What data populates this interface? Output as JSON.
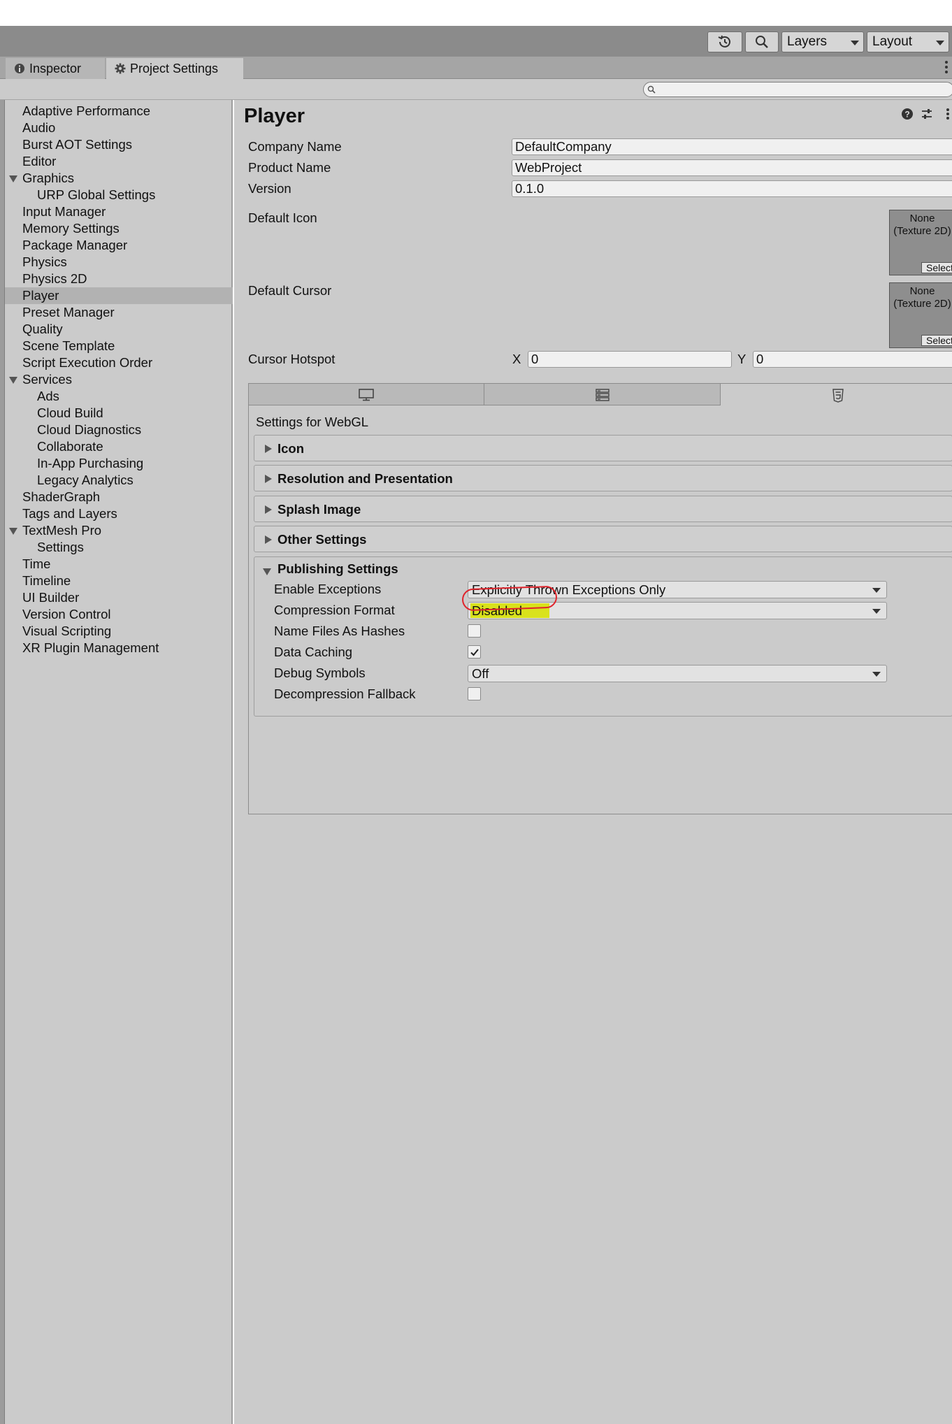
{
  "toolbar": {
    "history_icon": "history-icon",
    "search_icon": "search-icon",
    "layers_label": "Layers",
    "layout_label": "Layout"
  },
  "tabs": [
    {
      "label": "Inspector",
      "icon": "info-icon",
      "active": false
    },
    {
      "label": "Project Settings",
      "icon": "gear-icon",
      "active": true
    }
  ],
  "search": {
    "placeholder": ""
  },
  "sidebar": {
    "items": [
      {
        "label": "Adaptive Performance"
      },
      {
        "label": "Audio"
      },
      {
        "label": "Burst AOT Settings"
      },
      {
        "label": "Editor"
      },
      {
        "label": "Graphics",
        "expanded": true
      },
      {
        "label": "URP Global Settings"
      },
      {
        "label": "Input Manager"
      },
      {
        "label": "Memory Settings"
      },
      {
        "label": "Package Manager"
      },
      {
        "label": "Physics"
      },
      {
        "label": "Physics 2D"
      },
      {
        "label": "Player",
        "selected": true
      },
      {
        "label": "Preset Manager"
      },
      {
        "label": "Quality"
      },
      {
        "label": "Scene Template"
      },
      {
        "label": "Script Execution Order"
      },
      {
        "label": "Services",
        "expanded": true
      },
      {
        "label": "Ads"
      },
      {
        "label": "Cloud Build"
      },
      {
        "label": "Cloud Diagnostics"
      },
      {
        "label": "Collaborate"
      },
      {
        "label": "In-App Purchasing"
      },
      {
        "label": "Legacy Analytics"
      },
      {
        "label": "ShaderGraph"
      },
      {
        "label": "Tags and Layers"
      },
      {
        "label": "TextMesh Pro",
        "expanded": true
      },
      {
        "label": "Settings"
      },
      {
        "label": "Time"
      },
      {
        "label": "Timeline"
      },
      {
        "label": "UI Builder"
      },
      {
        "label": "Version Control"
      },
      {
        "label": "Visual Scripting"
      },
      {
        "label": "XR Plugin Management"
      }
    ]
  },
  "player": {
    "title": "Player",
    "company_name_label": "Company Name",
    "company_name_value": "DefaultCompany",
    "product_name_label": "Product Name",
    "product_name_value": "WebProject",
    "version_label": "Version",
    "version_value": "0.1.0",
    "default_icon_label": "Default Icon",
    "default_cursor_label": "Default Cursor",
    "texture_none": "None",
    "texture_type": "(Texture 2D)",
    "select_label": "Select",
    "cursor_hotspot_label": "Cursor Hotspot",
    "hotspot_x_label": "X",
    "hotspot_x_value": "0",
    "hotspot_y_label": "Y",
    "hotspot_y_value": "0"
  },
  "platform": {
    "tabs": [
      "desktop-icon",
      "server-icon",
      "html5-icon"
    ],
    "settings_for": "Settings for WebGL",
    "sections": [
      {
        "label": "Icon",
        "expanded": false
      },
      {
        "label": "Resolution and Presentation",
        "expanded": false
      },
      {
        "label": "Splash Image",
        "expanded": false
      },
      {
        "label": "Other Settings",
        "expanded": false
      },
      {
        "label": "Publishing Settings",
        "expanded": true
      }
    ]
  },
  "publishing": {
    "enable_exceptions_label": "Enable Exceptions",
    "enable_exceptions_value": "Explicitly Thrown Exceptions Only",
    "compression_format_label": "Compression Format",
    "compression_format_value": "Disabled",
    "name_files_label": "Name Files As Hashes",
    "name_files_checked": false,
    "data_caching_label": "Data Caching",
    "data_caching_checked": true,
    "debug_symbols_label": "Debug Symbols",
    "debug_symbols_value": "Off",
    "decompression_fallback_label": "Decompression Fallback",
    "decompression_fallback_checked": false
  },
  "colors": {
    "highlight": "#d9e21c",
    "annotation": "#e0242c",
    "panel": "#cbcbcb",
    "toolbar": "#8b8b8b"
  }
}
